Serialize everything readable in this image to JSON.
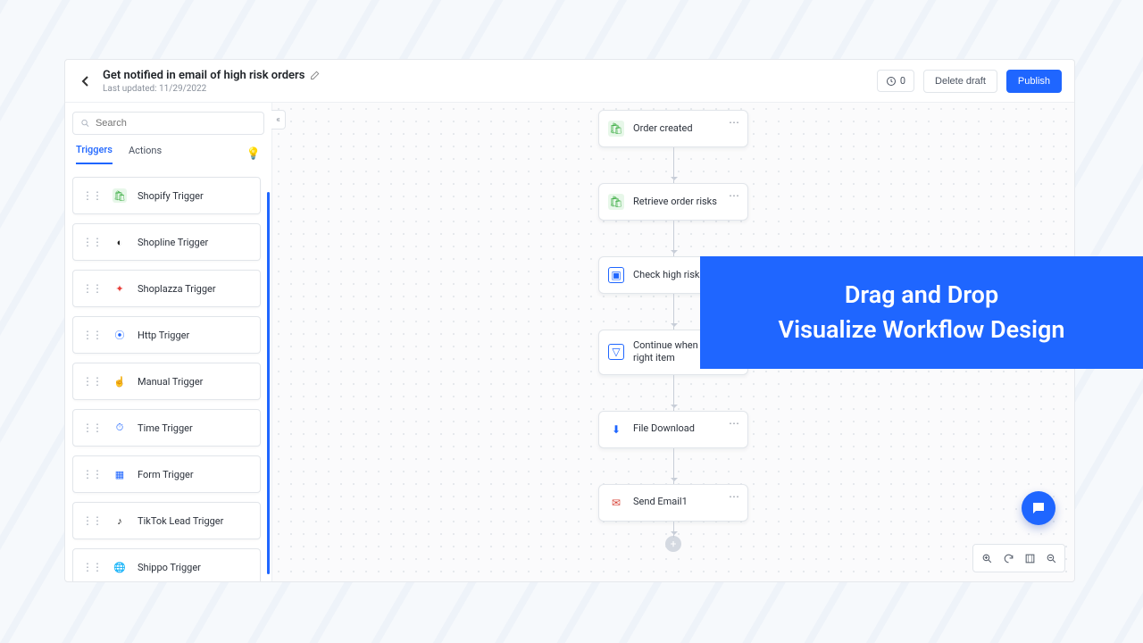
{
  "header": {
    "title": "Get notified in email of high risk orders",
    "last_updated_label": "Last updated: 11/29/2022",
    "history_count": "0",
    "delete_label": "Delete draft",
    "publish_label": "Publish"
  },
  "sidebar": {
    "search_placeholder": "Search",
    "tabs": {
      "triggers": "Triggers",
      "actions": "Actions"
    },
    "items": [
      {
        "label": "Shopify Trigger",
        "icon": "shopify-icon",
        "color": "#3fae46"
      },
      {
        "label": "Shopline Trigger",
        "icon": "shopline-icon",
        "color": "#222"
      },
      {
        "label": "Shoplazza Trigger",
        "icon": "shoplazza-icon",
        "color": "#e83f3a"
      },
      {
        "label": "Http Trigger",
        "icon": "http-icon",
        "color": "#1f66ff"
      },
      {
        "label": "Manual Trigger",
        "icon": "manual-icon",
        "color": "#1f66ff"
      },
      {
        "label": "Time Trigger",
        "icon": "time-icon",
        "color": "#1f66ff"
      },
      {
        "label": "Form Trigger",
        "icon": "form-icon",
        "color": "#1f66ff"
      },
      {
        "label": "TikTok Lead Trigger",
        "icon": "tiktok-icon",
        "color": "#111"
      },
      {
        "label": "Shippo Trigger",
        "icon": "shippo-icon",
        "color": "#222"
      }
    ]
  },
  "flow": {
    "nodes": [
      {
        "label": "Order created",
        "icon": "shopify-icon"
      },
      {
        "label": "Retrieve order risks",
        "icon": "shopify-icon"
      },
      {
        "label": "Check high risk",
        "icon": "check-square-icon"
      },
      {
        "label": "Continue when has high right item",
        "icon": "funnel-icon"
      },
      {
        "label": "File Download",
        "icon": "download-icon"
      },
      {
        "label": "Send Email1",
        "icon": "mail-icon"
      }
    ]
  },
  "promo": {
    "line1": "Drag and Drop",
    "line2": "Visualize Workflow Design"
  },
  "canvas_tools": {
    "zoom_in": "zoom-in-icon",
    "refresh": "refresh-icon",
    "fit": "fit-icon",
    "zoom_out": "zoom-out-icon"
  }
}
